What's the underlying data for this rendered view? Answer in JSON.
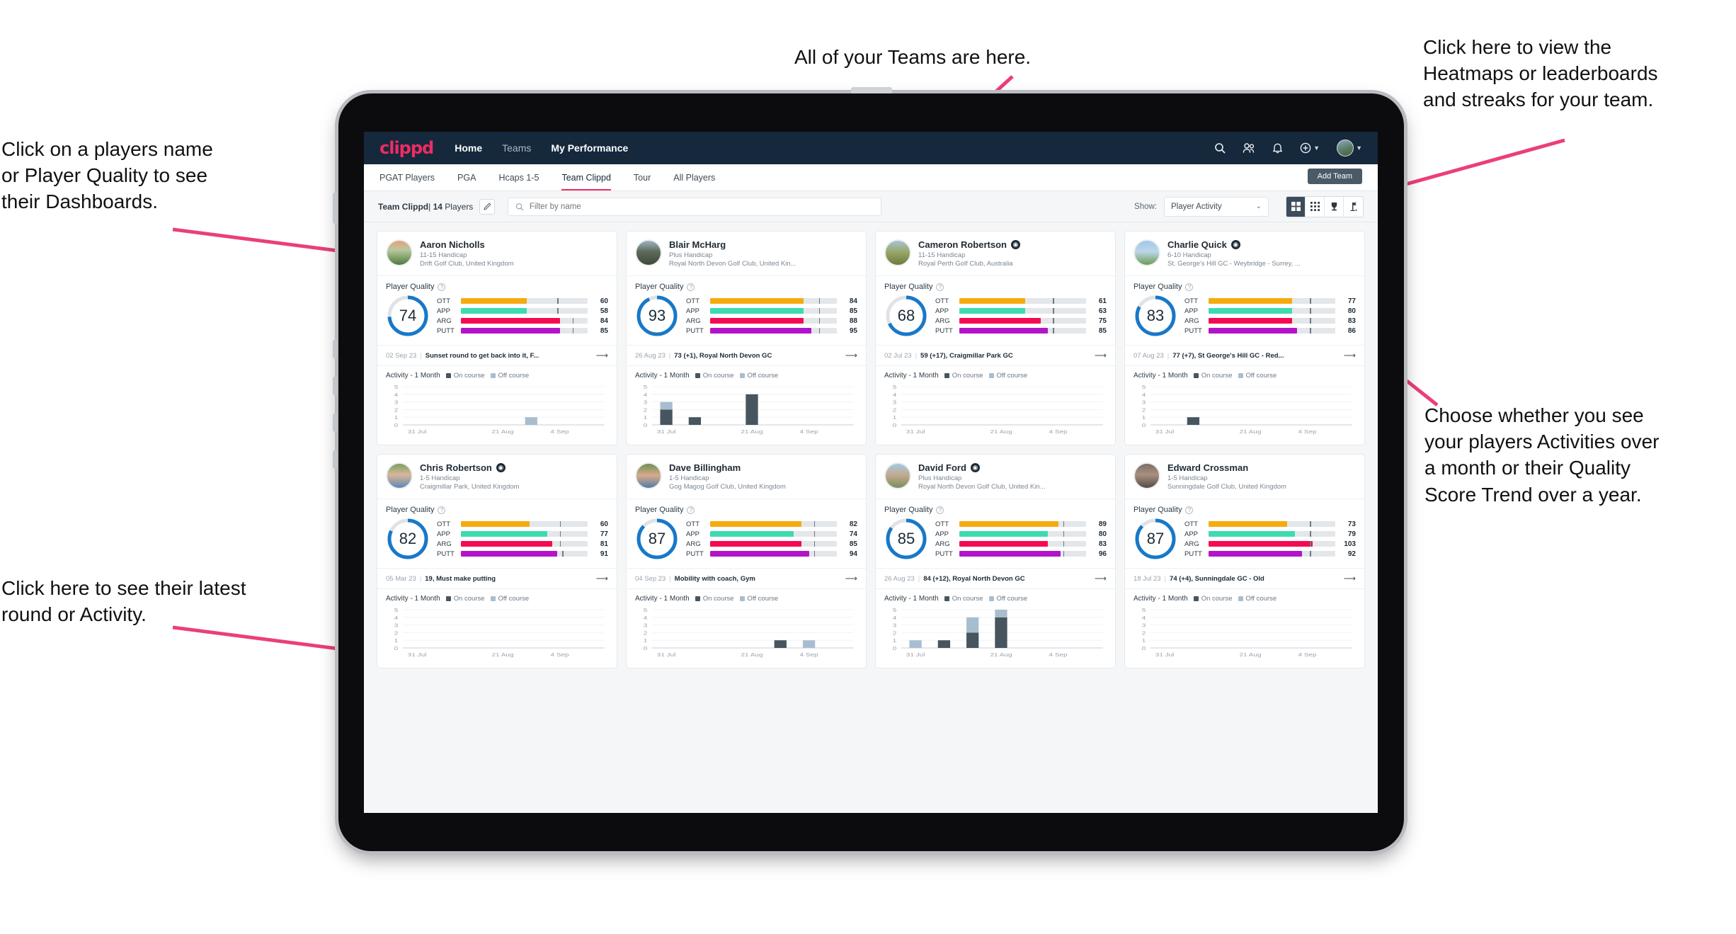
{
  "annotations": [
    {
      "id": "a-teams",
      "text": "All of your Teams are here."
    },
    {
      "id": "a-heatmap",
      "text": "Click here to view the\nHeatmaps or leaderboards\nand streaks for your team."
    },
    {
      "id": "a-names",
      "text": "Click on a players name\nor Player Quality to see\ntheir Dashboards."
    },
    {
      "id": "a-activity",
      "text": "Choose whether you see\nyour players Activities over\na month or their Quality\nScore Trend over a year."
    },
    {
      "id": "a-latest",
      "text": "Click here to see their latest\nround or Activity."
    }
  ],
  "navbar": {
    "brand": "clippd",
    "links": [
      {
        "label": "Home",
        "active": true
      },
      {
        "label": "Teams",
        "active": false
      },
      {
        "label": "My Performance",
        "active": true
      }
    ],
    "icons": [
      "search-icon",
      "people-icon",
      "bell-icon",
      "plus-circle-icon",
      "avatar"
    ]
  },
  "subtabs": {
    "items": [
      {
        "label": "PGAT Players",
        "active": false
      },
      {
        "label": "PGA",
        "active": false
      },
      {
        "label": "Hcaps 1-5",
        "active": false
      },
      {
        "label": "Team Clippd",
        "active": true
      },
      {
        "label": "Tour",
        "active": false
      },
      {
        "label": "All Players",
        "active": false
      }
    ],
    "add_team_label": "Add Team"
  },
  "filterbar": {
    "team_name": "Team Clippd",
    "separator": "|",
    "player_count": "14",
    "players_word": "Players",
    "edit_icon": "pencil-icon",
    "search_placeholder": "Filter by name",
    "search_value": "",
    "show_label": "Show:",
    "show_value": "Player Activity",
    "show_options": [
      "Player Activity",
      "Quality Score Trend"
    ],
    "view_toggles": [
      {
        "icon": "grid-large-icon",
        "active": true
      },
      {
        "icon": "grid-small-icon",
        "active": false
      },
      {
        "icon": "trophy-icon",
        "active": false
      },
      {
        "icon": "flag-icon",
        "active": false
      }
    ]
  },
  "card_labels": {
    "player_quality": "Player Quality",
    "activity": "Activity - 1 Month",
    "legend_on": "On course",
    "legend_off": "Off course",
    "metric_names": [
      "OTT",
      "APP",
      "ARG",
      "PUTT"
    ]
  },
  "colors": {
    "brand_pink": "#ef2b62",
    "navy": "#15283c",
    "ring_blue": "#1878c8",
    "ott": "#f5ab0e",
    "app": "#3ddbb0",
    "arg": "#f50a52",
    "putt": "#b314c9",
    "on_course": "#47555f",
    "off_course": "#a8bed0"
  },
  "players": [
    {
      "name": "Aaron Nicholls",
      "verified": false,
      "handicap": "11-15 Handicap",
      "club": "Drift Golf Club, United Kingdom",
      "quality": 74,
      "metrics": [
        {
          "name": "OTT",
          "value": 60,
          "fill": 52,
          "tick": 76
        },
        {
          "name": "APP",
          "value": 58,
          "fill": 52,
          "tick": 76
        },
        {
          "name": "ARG",
          "value": 84,
          "fill": 78,
          "tick": 88
        },
        {
          "name": "PUTT",
          "value": 85,
          "fill": 78,
          "tick": 88
        }
      ],
      "round": {
        "date": "02 Sep 23",
        "text": "Sunset round to get back into it, F..."
      },
      "chart_data": {
        "type": "bar",
        "title": "Activity - 1 Month",
        "categories": [
          "31 Jul",
          "21 Aug",
          "4 Sep"
        ],
        "ylim": [
          0,
          5
        ],
        "yticks": [
          0,
          1,
          2,
          3,
          4,
          5
        ],
        "series": [
          {
            "name": "On course",
            "values": [
              0,
              0,
              0,
              0,
              0,
              0,
              0
            ]
          },
          {
            "name": "Off course",
            "values": [
              0,
              0,
              0,
              0,
              1,
              0,
              0
            ]
          }
        ]
      }
    },
    {
      "name": "Blair McHarg",
      "verified": false,
      "handicap": "Plus Handicap",
      "club": "Royal North Devon Golf Club, United Kin...",
      "quality": 93,
      "metrics": [
        {
          "name": "OTT",
          "value": 84,
          "fill": 74,
          "tick": 86
        },
        {
          "name": "APP",
          "value": 85,
          "fill": 74,
          "tick": 86
        },
        {
          "name": "ARG",
          "value": 88,
          "fill": 74,
          "tick": 86
        },
        {
          "name": "PUTT",
          "value": 95,
          "fill": 80,
          "tick": 86
        }
      ],
      "round": {
        "date": "26 Aug 23",
        "text": "73 (+1), Royal North Devon GC"
      },
      "chart_data": {
        "type": "bar",
        "title": "Activity - 1 Month",
        "categories": [
          "31 Jul",
          "21 Aug",
          "4 Sep"
        ],
        "ylim": [
          0,
          5
        ],
        "yticks": [
          0,
          1,
          2,
          3,
          4,
          5
        ],
        "series": [
          {
            "name": "On course",
            "values": [
              2,
              1,
              0,
              4,
              0,
              0,
              0
            ]
          },
          {
            "name": "Off course",
            "values": [
              1,
              0,
              0,
              0,
              0,
              0,
              0
            ]
          }
        ]
      }
    },
    {
      "name": "Cameron Robertson",
      "verified": true,
      "handicap": "11-15 Handicap",
      "club": "Royal Perth Golf Club, Australia",
      "quality": 68,
      "metrics": [
        {
          "name": "OTT",
          "value": 61,
          "fill": 52,
          "tick": 74
        },
        {
          "name": "APP",
          "value": 63,
          "fill": 52,
          "tick": 74
        },
        {
          "name": "ARG",
          "value": 75,
          "fill": 64,
          "tick": 74
        },
        {
          "name": "PUTT",
          "value": 85,
          "fill": 70,
          "tick": 74
        }
      ],
      "round": {
        "date": "02 Jul 23",
        "text": "59 (+17), Craigmillar Park GC"
      },
      "chart_data": {
        "type": "bar",
        "title": "Activity - 1 Month",
        "categories": [
          "31 Jul",
          "21 Aug",
          "4 Sep"
        ],
        "ylim": [
          0,
          5
        ],
        "yticks": [
          0,
          1,
          2,
          3,
          4,
          5
        ],
        "series": [
          {
            "name": "On course",
            "values": [
              0,
              0,
              0,
              0,
              0,
              0,
              0
            ]
          },
          {
            "name": "Off course",
            "values": [
              0,
              0,
              0,
              0,
              0,
              0,
              0
            ]
          }
        ]
      }
    },
    {
      "name": "Charlie Quick",
      "verified": true,
      "handicap": "6-10 Handicap",
      "club": "St. George's Hill GC - Weybridge - Surrey, ...",
      "quality": 83,
      "metrics": [
        {
          "name": "OTT",
          "value": 77,
          "fill": 66,
          "tick": 80
        },
        {
          "name": "APP",
          "value": 80,
          "fill": 66,
          "tick": 80
        },
        {
          "name": "ARG",
          "value": 83,
          "fill": 66,
          "tick": 80
        },
        {
          "name": "PUTT",
          "value": 86,
          "fill": 70,
          "tick": 80
        }
      ],
      "round": {
        "date": "07 Aug 23",
        "text": "77 (+7), St George's Hill GC - Red..."
      },
      "chart_data": {
        "type": "bar",
        "title": "Activity - 1 Month",
        "categories": [
          "31 Jul",
          "21 Aug",
          "4 Sep"
        ],
        "ylim": [
          0,
          5
        ],
        "yticks": [
          0,
          1,
          2,
          3,
          4,
          5
        ],
        "series": [
          {
            "name": "On course",
            "values": [
              0,
              1,
              0,
              0,
              0,
              0,
              0
            ]
          },
          {
            "name": "Off course",
            "values": [
              0,
              0,
              0,
              0,
              0,
              0,
              0
            ]
          }
        ]
      }
    },
    {
      "name": "Chris Robertson",
      "verified": true,
      "handicap": "1-5 Handicap",
      "club": "Craigmillar Park, United Kingdom",
      "quality": 82,
      "metrics": [
        {
          "name": "OTT",
          "value": 60,
          "fill": 54,
          "tick": 78
        },
        {
          "name": "APP",
          "value": 77,
          "fill": 68,
          "tick": 78
        },
        {
          "name": "ARG",
          "value": 81,
          "fill": 72,
          "tick": 78
        },
        {
          "name": "PUTT",
          "value": 91,
          "fill": 76,
          "tick": 80
        }
      ],
      "round": {
        "date": "05 Mar 23",
        "text": "19, Must make putting"
      },
      "chart_data": {
        "type": "bar",
        "title": "Activity - 1 Month",
        "categories": [
          "31 Jul",
          "21 Aug",
          "4 Sep"
        ],
        "ylim": [
          0,
          5
        ],
        "yticks": [
          0,
          1,
          2,
          3,
          4,
          5
        ],
        "series": [
          {
            "name": "On course",
            "values": [
              0,
              0,
              0,
              0,
              0,
              0,
              0
            ]
          },
          {
            "name": "Off course",
            "values": [
              0,
              0,
              0,
              0,
              0,
              0,
              0
            ]
          }
        ]
      }
    },
    {
      "name": "Dave Billingham",
      "verified": false,
      "handicap": "1-5 Handicap",
      "club": "Gog Magog Golf Club, United Kingdom",
      "quality": 87,
      "metrics": [
        {
          "name": "OTT",
          "value": 82,
          "fill": 72,
          "tick": 82
        },
        {
          "name": "APP",
          "value": 74,
          "fill": 66,
          "tick": 82
        },
        {
          "name": "ARG",
          "value": 85,
          "fill": 72,
          "tick": 82
        },
        {
          "name": "PUTT",
          "value": 94,
          "fill": 78,
          "tick": 82
        }
      ],
      "round": {
        "date": "04 Sep 23",
        "text": "Mobility with coach, Gym"
      },
      "chart_data": {
        "type": "bar",
        "title": "Activity - 1 Month",
        "categories": [
          "31 Jul",
          "21 Aug",
          "4 Sep"
        ],
        "ylim": [
          0,
          5
        ],
        "yticks": [
          0,
          1,
          2,
          3,
          4,
          5
        ],
        "series": [
          {
            "name": "On course",
            "values": [
              0,
              0,
              0,
              0,
              1,
              0,
              0
            ]
          },
          {
            "name": "Off course",
            "values": [
              0,
              0,
              0,
              0,
              0,
              1,
              0
            ]
          }
        ]
      }
    },
    {
      "name": "David Ford",
      "verified": true,
      "handicap": "Plus Handicap",
      "club": "Royal North Devon Golf Club, United Kin...",
      "quality": 85,
      "metrics": [
        {
          "name": "OTT",
          "value": 89,
          "fill": 78,
          "tick": 82
        },
        {
          "name": "APP",
          "value": 80,
          "fill": 70,
          "tick": 82
        },
        {
          "name": "ARG",
          "value": 83,
          "fill": 70,
          "tick": 82
        },
        {
          "name": "PUTT",
          "value": 96,
          "fill": 80,
          "tick": 82
        }
      ],
      "round": {
        "date": "26 Aug 23",
        "text": "84 (+12), Royal North Devon GC"
      },
      "chart_data": {
        "type": "bar",
        "title": "Activity - 1 Month",
        "categories": [
          "31 Jul",
          "21 Aug",
          "4 Sep"
        ],
        "ylim": [
          0,
          5
        ],
        "yticks": [
          0,
          1,
          2,
          3,
          4,
          5
        ],
        "series": [
          {
            "name": "On course",
            "values": [
              0,
              1,
              2,
              4,
              0,
              0,
              0
            ]
          },
          {
            "name": "Off course",
            "values": [
              1,
              0,
              2,
              1,
              0,
              0,
              0
            ]
          }
        ]
      }
    },
    {
      "name": "Edward Crossman",
      "verified": false,
      "handicap": "1-5 Handicap",
      "club": "Sunningdale Golf Club, United Kingdom",
      "quality": 87,
      "metrics": [
        {
          "name": "OTT",
          "value": 73,
          "fill": 62,
          "tick": 80
        },
        {
          "name": "APP",
          "value": 79,
          "fill": 68,
          "tick": 80
        },
        {
          "name": "ARG",
          "value": 103,
          "fill": 82,
          "tick": 80
        },
        {
          "name": "PUTT",
          "value": 92,
          "fill": 74,
          "tick": 80
        }
      ],
      "round": {
        "date": "18 Jul 23",
        "text": "74 (+4), Sunningdale GC - Old"
      },
      "chart_data": {
        "type": "bar",
        "title": "Activity - 1 Month",
        "categories": [
          "31 Jul",
          "21 Aug",
          "4 Sep"
        ],
        "ylim": [
          0,
          5
        ],
        "yticks": [
          0,
          1,
          2,
          3,
          4,
          5
        ],
        "series": [
          {
            "name": "On course",
            "values": [
              0,
              0,
              0,
              0,
              0,
              0,
              0
            ]
          },
          {
            "name": "Off course",
            "values": [
              0,
              0,
              0,
              0,
              0,
              0,
              0
            ]
          }
        ]
      }
    }
  ]
}
